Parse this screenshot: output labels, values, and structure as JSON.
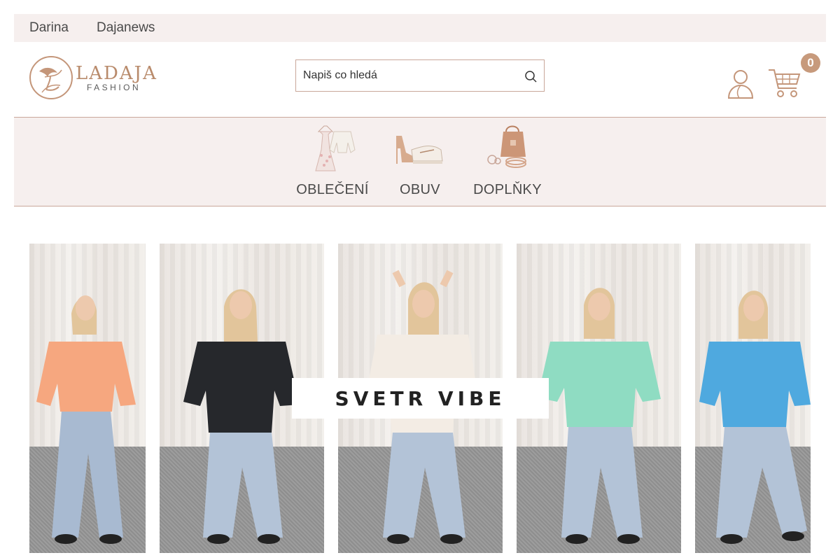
{
  "topbar": {
    "links": [
      "Darina",
      "Dajanews"
    ]
  },
  "logo": {
    "title": "LADAJA",
    "subtitle": "FASHION"
  },
  "search": {
    "placeholder": "Napiš co hledá"
  },
  "cart": {
    "count": "0"
  },
  "categories": [
    {
      "label": "OBLEČENÍ",
      "icon": "clothing-icon"
    },
    {
      "label": "OBUV",
      "icon": "shoes-icon"
    },
    {
      "label": "DOPLŇKY",
      "icon": "accessories-icon"
    }
  ],
  "banner": {
    "title": "SVETR VIBE",
    "photos": [
      {
        "top_color": "#f6a77f"
      },
      {
        "top_color": "#26282c"
      },
      {
        "top_color": "#f3ece4"
      },
      {
        "top_color": "#8fdcc2"
      },
      {
        "top_color": "#4fa9df"
      }
    ]
  },
  "colors": {
    "accent": "#c79a7c",
    "panel": "#f6efee",
    "border": "#c9a79a"
  }
}
